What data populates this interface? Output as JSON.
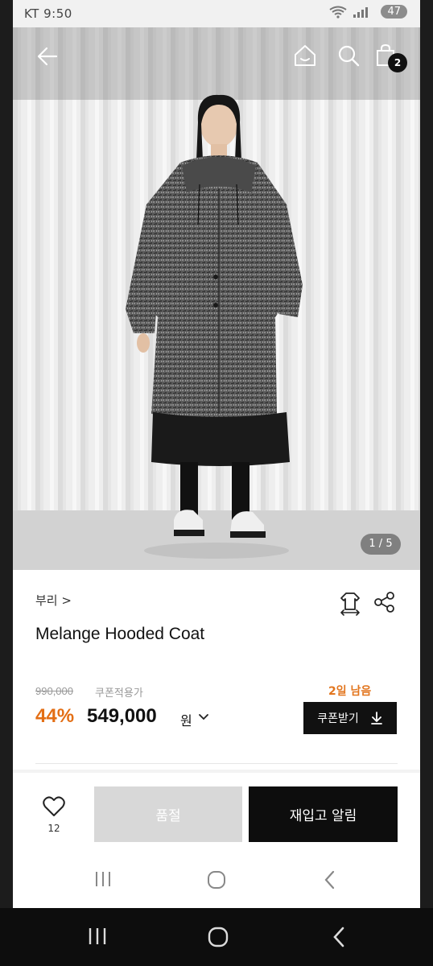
{
  "status_bar": {
    "carrier_time": "KT 9:50",
    "battery": "47"
  },
  "hero": {
    "page_indicator": "1 / 5",
    "cart_count": "2"
  },
  "product": {
    "brand": "부리 >",
    "title": "Melange Hooded Coat",
    "original_price": "990,000",
    "coupon_label": "쿠폰적용가",
    "days_left": "2일 남음",
    "discount": "44%",
    "price": "549,000",
    "currency": "원"
  },
  "actions": {
    "coupon_button": "쿠폰받기",
    "like_count": "12",
    "soldout_button": "품절",
    "restock_button": "재입고 알림"
  },
  "icons": {
    "back": "back-arrow-icon",
    "home": "home-icon",
    "search": "search-icon",
    "cart": "shopping-bag-icon",
    "hanger": "hanger-icon",
    "share": "share-icon",
    "heart": "heart-icon",
    "download": "download-icon"
  }
}
